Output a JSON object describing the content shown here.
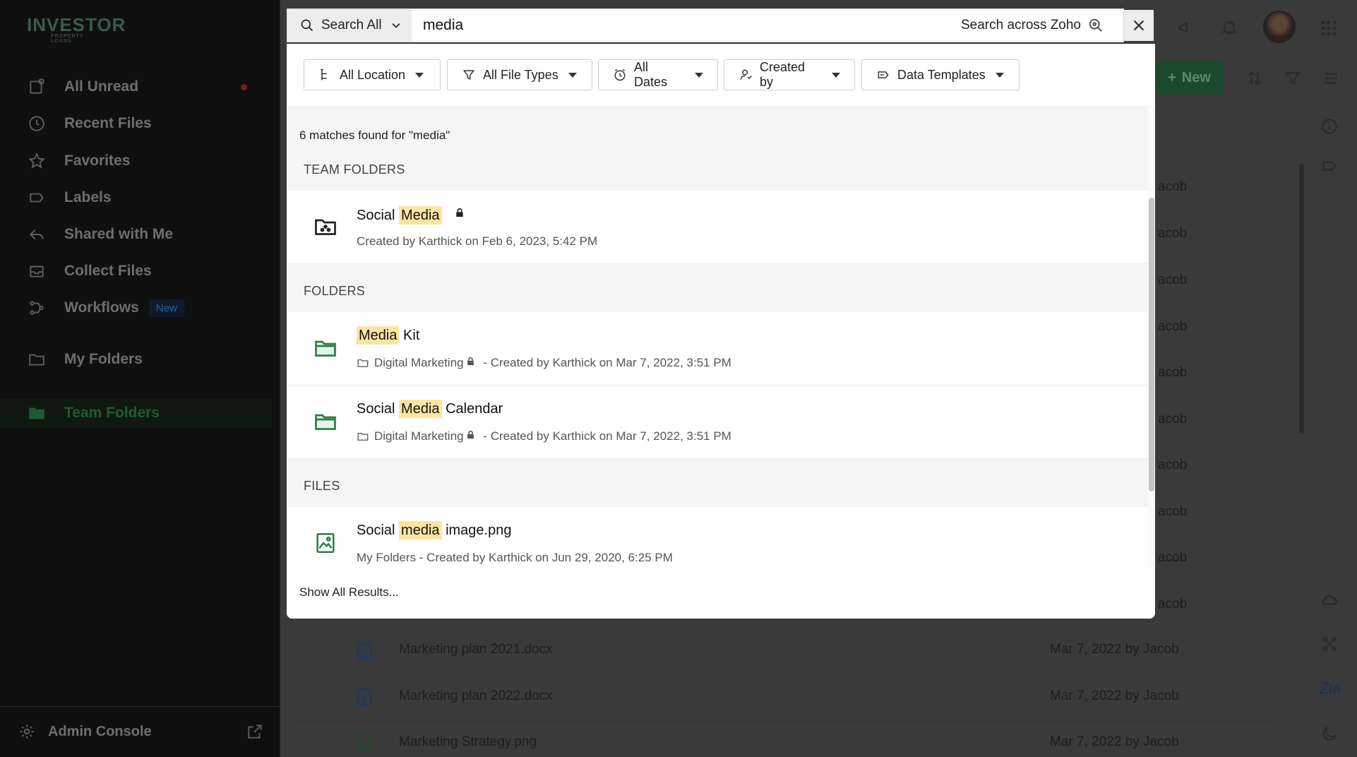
{
  "sidebar": {
    "logo_text": "INVESTOR",
    "logo_sub": "PROPERTY LOANS",
    "items": [
      {
        "label": "All Unread",
        "icon": "unread-icon"
      },
      {
        "label": "Recent Files",
        "icon": "clock-icon"
      },
      {
        "label": "Favorites",
        "icon": "star-icon"
      },
      {
        "label": "Labels",
        "icon": "label-icon"
      },
      {
        "label": "Shared with Me",
        "icon": "share-icon"
      },
      {
        "label": "Collect Files",
        "icon": "inbox-icon"
      },
      {
        "label": "Workflows",
        "icon": "workflow-icon",
        "badge": "New"
      },
      {
        "label": "My Folders",
        "icon": "folder-icon"
      },
      {
        "label": "Team Folders",
        "icon": "team-folder-icon"
      }
    ],
    "admin_label": "Admin Console"
  },
  "main": {
    "new_button": "New",
    "rows_partial": [
      "acob",
      "acob",
      "acob",
      "acob",
      "acob",
      "acob",
      "acob",
      "acob",
      "acob",
      "acob"
    ],
    "files": [
      {
        "name": "Marketing plan 2021.docx",
        "meta": "Mar 7, 2022 by Jacob"
      },
      {
        "name": "Marketing plan 2022.docx",
        "meta": "Mar 7, 2022 by Jacob"
      },
      {
        "name": "Marketing Strategy.png",
        "meta": "Mar 7, 2022 by Jacob"
      }
    ]
  },
  "search": {
    "scope": "Search All",
    "query": "media",
    "across_label": "Search across Zoho",
    "filters": [
      "All Location",
      "All File Types",
      "All Dates",
      "Created by",
      "Data Templates"
    ],
    "count_text": "6 matches found for \"media\"",
    "sections": {
      "team_folders": "TEAM FOLDERS",
      "folders": "FOLDERS",
      "files": "FILES"
    },
    "results": {
      "team": {
        "pre": "Social ",
        "hl": "Media",
        "post": "",
        "sub": "Created by Karthick on Feb 6, 2023, 5:42 PM"
      },
      "folder1": {
        "pre": "",
        "hl": "Media",
        "post": " Kit",
        "loc": "Digital Marketing",
        "sub": " - Created by Karthick on Mar 7, 2022, 3:51 PM"
      },
      "folder2": {
        "pre": "Social ",
        "hl": "Media",
        "post": " Calendar",
        "loc": "Digital Marketing",
        "sub": " - Created by Karthick on Mar 7, 2022, 3:51 PM"
      },
      "file1": {
        "pre": "Social ",
        "hl": "media",
        "post": " image.png",
        "sub": "My Folders - Created by Karthick on Jun 29, 2020, 6:25 PM"
      }
    },
    "show_all": "Show All Results..."
  },
  "colors": {
    "accent_green": "#2e7d45",
    "highlight": "#fde4a0",
    "dim_overlay": "#3a3a3a"
  }
}
